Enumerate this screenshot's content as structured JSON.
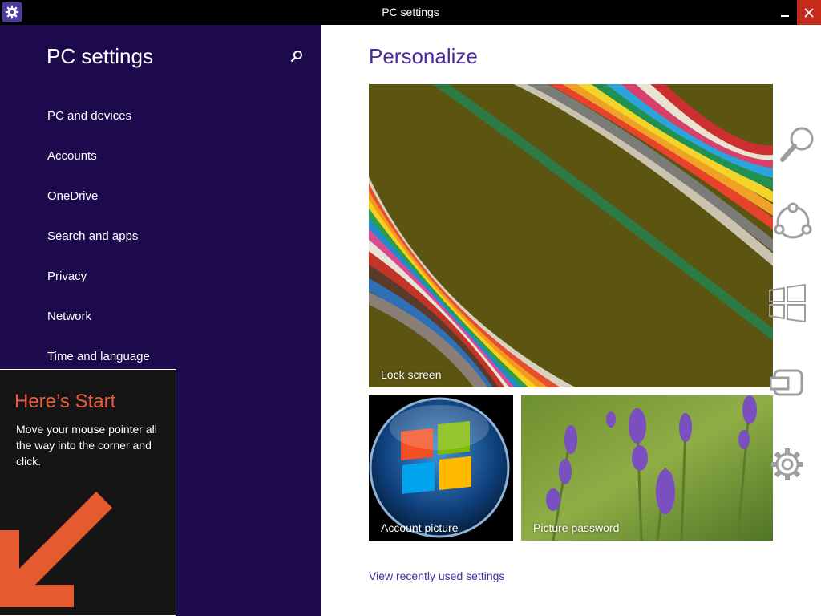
{
  "window": {
    "title": "PC settings",
    "accent": "#4e39a3",
    "close_color": "#c42b1c"
  },
  "sidebar": {
    "title": "PC settings",
    "background": "#1c0a4c",
    "items": [
      {
        "label": "PC and devices"
      },
      {
        "label": "Accounts"
      },
      {
        "label": "OneDrive"
      },
      {
        "label": "Search and apps"
      },
      {
        "label": "Privacy"
      },
      {
        "label": "Network"
      },
      {
        "label": "Time and language"
      }
    ]
  },
  "start_tip": {
    "title": "Here’s Start",
    "body": "Move your mouse pointer all the way into the corner and click.",
    "accent": "#ef5b3a"
  },
  "main": {
    "title": "Personalize",
    "tiles": {
      "lock_screen": "Lock screen",
      "account_picture": "Account picture",
      "picture_password": "Picture password"
    },
    "recent_link": "View recently used settings"
  },
  "charms": [
    "search-icon",
    "share-icon",
    "start-icon",
    "devices-icon",
    "settings-icon"
  ]
}
